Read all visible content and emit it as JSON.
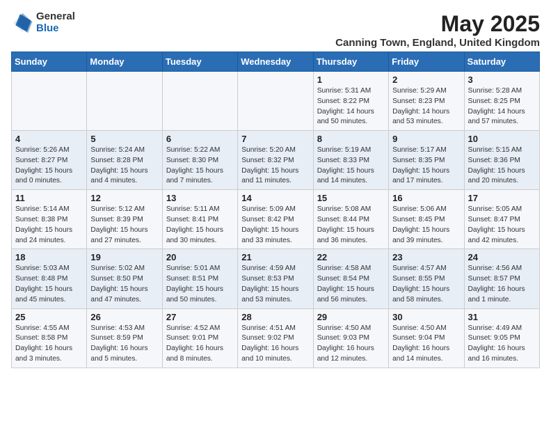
{
  "header": {
    "logo_general": "General",
    "logo_blue": "Blue",
    "month_title": "May 2025",
    "location": "Canning Town, England, United Kingdom"
  },
  "days_of_week": [
    "Sunday",
    "Monday",
    "Tuesday",
    "Wednesday",
    "Thursday",
    "Friday",
    "Saturday"
  ],
  "weeks": [
    [
      {
        "day": "",
        "content": ""
      },
      {
        "day": "",
        "content": ""
      },
      {
        "day": "",
        "content": ""
      },
      {
        "day": "",
        "content": ""
      },
      {
        "day": "1",
        "content": "Sunrise: 5:31 AM\nSunset: 8:22 PM\nDaylight: 14 hours\nand 50 minutes."
      },
      {
        "day": "2",
        "content": "Sunrise: 5:29 AM\nSunset: 8:23 PM\nDaylight: 14 hours\nand 53 minutes."
      },
      {
        "day": "3",
        "content": "Sunrise: 5:28 AM\nSunset: 8:25 PM\nDaylight: 14 hours\nand 57 minutes."
      }
    ],
    [
      {
        "day": "4",
        "content": "Sunrise: 5:26 AM\nSunset: 8:27 PM\nDaylight: 15 hours\nand 0 minutes."
      },
      {
        "day": "5",
        "content": "Sunrise: 5:24 AM\nSunset: 8:28 PM\nDaylight: 15 hours\nand 4 minutes."
      },
      {
        "day": "6",
        "content": "Sunrise: 5:22 AM\nSunset: 8:30 PM\nDaylight: 15 hours\nand 7 minutes."
      },
      {
        "day": "7",
        "content": "Sunrise: 5:20 AM\nSunset: 8:32 PM\nDaylight: 15 hours\nand 11 minutes."
      },
      {
        "day": "8",
        "content": "Sunrise: 5:19 AM\nSunset: 8:33 PM\nDaylight: 15 hours\nand 14 minutes."
      },
      {
        "day": "9",
        "content": "Sunrise: 5:17 AM\nSunset: 8:35 PM\nDaylight: 15 hours\nand 17 minutes."
      },
      {
        "day": "10",
        "content": "Sunrise: 5:15 AM\nSunset: 8:36 PM\nDaylight: 15 hours\nand 20 minutes."
      }
    ],
    [
      {
        "day": "11",
        "content": "Sunrise: 5:14 AM\nSunset: 8:38 PM\nDaylight: 15 hours\nand 24 minutes."
      },
      {
        "day": "12",
        "content": "Sunrise: 5:12 AM\nSunset: 8:39 PM\nDaylight: 15 hours\nand 27 minutes."
      },
      {
        "day": "13",
        "content": "Sunrise: 5:11 AM\nSunset: 8:41 PM\nDaylight: 15 hours\nand 30 minutes."
      },
      {
        "day": "14",
        "content": "Sunrise: 5:09 AM\nSunset: 8:42 PM\nDaylight: 15 hours\nand 33 minutes."
      },
      {
        "day": "15",
        "content": "Sunrise: 5:08 AM\nSunset: 8:44 PM\nDaylight: 15 hours\nand 36 minutes."
      },
      {
        "day": "16",
        "content": "Sunrise: 5:06 AM\nSunset: 8:45 PM\nDaylight: 15 hours\nand 39 minutes."
      },
      {
        "day": "17",
        "content": "Sunrise: 5:05 AM\nSunset: 8:47 PM\nDaylight: 15 hours\nand 42 minutes."
      }
    ],
    [
      {
        "day": "18",
        "content": "Sunrise: 5:03 AM\nSunset: 8:48 PM\nDaylight: 15 hours\nand 45 minutes."
      },
      {
        "day": "19",
        "content": "Sunrise: 5:02 AM\nSunset: 8:50 PM\nDaylight: 15 hours\nand 47 minutes."
      },
      {
        "day": "20",
        "content": "Sunrise: 5:01 AM\nSunset: 8:51 PM\nDaylight: 15 hours\nand 50 minutes."
      },
      {
        "day": "21",
        "content": "Sunrise: 4:59 AM\nSunset: 8:53 PM\nDaylight: 15 hours\nand 53 minutes."
      },
      {
        "day": "22",
        "content": "Sunrise: 4:58 AM\nSunset: 8:54 PM\nDaylight: 15 hours\nand 56 minutes."
      },
      {
        "day": "23",
        "content": "Sunrise: 4:57 AM\nSunset: 8:55 PM\nDaylight: 15 hours\nand 58 minutes."
      },
      {
        "day": "24",
        "content": "Sunrise: 4:56 AM\nSunset: 8:57 PM\nDaylight: 16 hours\nand 1 minute."
      }
    ],
    [
      {
        "day": "25",
        "content": "Sunrise: 4:55 AM\nSunset: 8:58 PM\nDaylight: 16 hours\nand 3 minutes."
      },
      {
        "day": "26",
        "content": "Sunrise: 4:53 AM\nSunset: 8:59 PM\nDaylight: 16 hours\nand 5 minutes."
      },
      {
        "day": "27",
        "content": "Sunrise: 4:52 AM\nSunset: 9:01 PM\nDaylight: 16 hours\nand 8 minutes."
      },
      {
        "day": "28",
        "content": "Sunrise: 4:51 AM\nSunset: 9:02 PM\nDaylight: 16 hours\nand 10 minutes."
      },
      {
        "day": "29",
        "content": "Sunrise: 4:50 AM\nSunset: 9:03 PM\nDaylight: 16 hours\nand 12 minutes."
      },
      {
        "day": "30",
        "content": "Sunrise: 4:50 AM\nSunset: 9:04 PM\nDaylight: 16 hours\nand 14 minutes."
      },
      {
        "day": "31",
        "content": "Sunrise: 4:49 AM\nSunset: 9:05 PM\nDaylight: 16 hours\nand 16 minutes."
      }
    ]
  ]
}
